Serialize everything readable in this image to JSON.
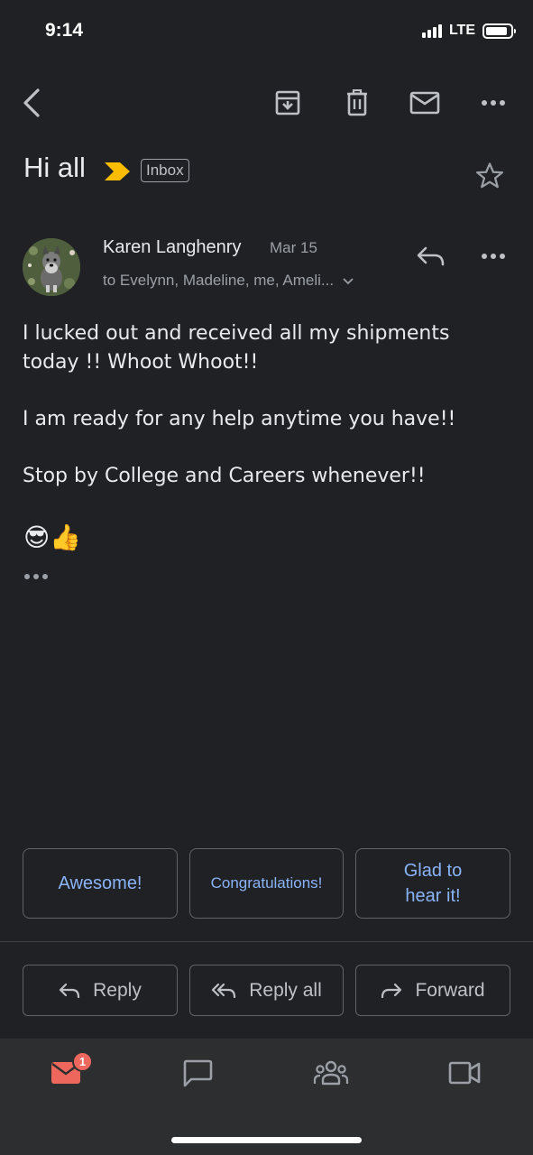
{
  "status_bar": {
    "time": "9:14",
    "network": "LTE",
    "battery_level": 0.9
  },
  "toolbar": {
    "back_icon": "arrow-back-icon",
    "archive_icon": "archive-icon",
    "delete_icon": "trash-icon",
    "mark_unread_icon": "mail-icon",
    "more_icon": "more-horizontal-icon"
  },
  "email": {
    "subject": "Hi all",
    "label": "Inbox",
    "sender": "Karen Langhenry",
    "date": "Mar 15",
    "recipients": "to Evelynn, Madeline, me, Ameli...",
    "body": [
      "I lucked out and received all my shipments today !!   Whoot Whoot!!",
      "I am ready for any help anytime you have!!",
      "Stop by College and Careers whenever!!"
    ],
    "emojis": [
      "😎",
      "👍"
    ]
  },
  "smart_replies": [
    "Awesome!",
    "Congratulations!",
    "Glad to hear it!"
  ],
  "actions": {
    "reply": "Reply",
    "reply_all": "Reply all",
    "forward": "Forward"
  },
  "bottom_nav": {
    "mail_badge": "1",
    "items": [
      "mail-icon",
      "chat-icon",
      "spaces-icon",
      "meet-icon"
    ]
  },
  "colors": {
    "background": "#202124",
    "accent": "#8ab4f8",
    "badge": "#ee675c",
    "importance": "#fbbc04"
  }
}
